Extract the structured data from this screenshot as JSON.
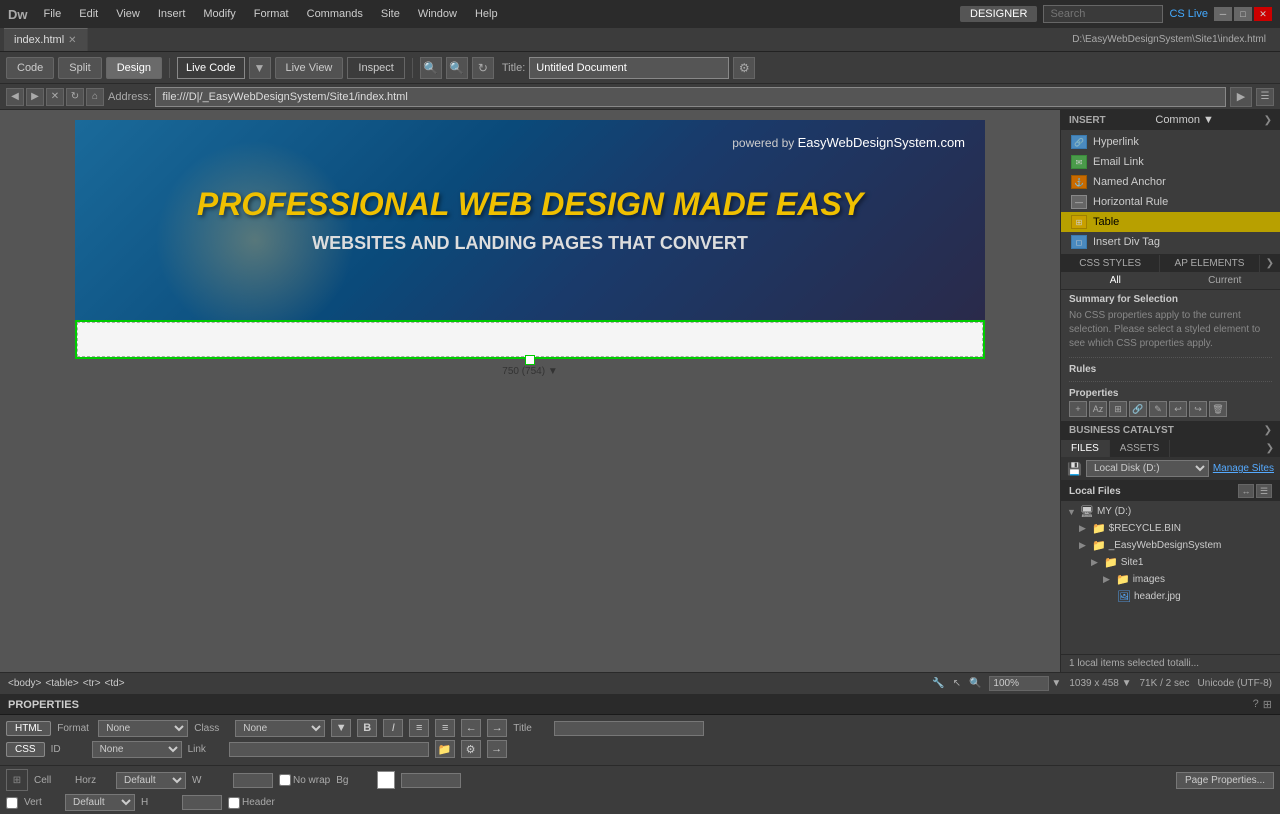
{
  "app": {
    "logo": "Dw",
    "designer_label": "DESIGNER",
    "search_placeholder": "Search",
    "cs_live_label": "CS Live"
  },
  "menu": {
    "items": [
      "File",
      "Edit",
      "View",
      "Insert",
      "Modify",
      "Format",
      "Commands",
      "Site",
      "Window",
      "Help"
    ]
  },
  "tab": {
    "name": "index.html",
    "path": "D:\\EasyWebDesignSystem\\Site1\\index.html"
  },
  "toolbar": {
    "code_label": "Code",
    "split_label": "Split",
    "design_label": "Design",
    "live_code_label": "Live Code",
    "live_view_label": "Live View",
    "inspect_label": "Inspect",
    "title_label": "Title:",
    "title_value": "Untitled Document"
  },
  "address": {
    "label": "Address:",
    "value": "file:///D|/_EasyWebDesignSystem/Site1/index.html"
  },
  "banner": {
    "powered_by": "powered by",
    "brand": "EasyWebDesignSystem.com",
    "title": "PROFESSIONAL WEB DESIGN MADE EASY",
    "subtitle": "WEBSITES AND LANDING PAGES THAT CONVERT"
  },
  "selection": {
    "width_label": "750 (754) ▼"
  },
  "status": {
    "breadcrumb": [
      "<body>",
      "<table>",
      "<tr>",
      "<td>"
    ],
    "zoom": "100%",
    "dimensions": "1039 x 458 ▼",
    "file_size": "71K / 2 sec",
    "encoding": "Unicode (UTF-8)"
  },
  "right_panel": {
    "insert_title": "INSERT",
    "common_label": "Common",
    "insert_items": [
      {
        "label": "Hyperlink",
        "icon": "🔗",
        "type": "link"
      },
      {
        "label": "Email Link",
        "icon": "✉",
        "type": "email"
      },
      {
        "label": "Named Anchor",
        "icon": "⚓",
        "type": "anchor"
      },
      {
        "label": "Horizontal Rule",
        "icon": "—",
        "type": "hr"
      },
      {
        "label": "Table",
        "icon": "⊞",
        "type": "table",
        "highlighted": true
      },
      {
        "label": "Insert Div Tag",
        "icon": "◻",
        "type": "div"
      }
    ],
    "css_title": "CSS STYLES",
    "ap_title": "AP ELEMENTS",
    "css_tab_all": "All",
    "css_tab_current": "Current",
    "css_summary": "Summary for Selection",
    "css_no_props": "No CSS properties apply to the current selection.  Please select a styled element to see which CSS properties apply.",
    "css_rules": "Rules",
    "css_properties": "Properties",
    "bc_title": "BUSINESS CATALYST",
    "files_tab": "FILES",
    "assets_tab": "ASSETS",
    "disk_label": "Local Disk (D:)",
    "manage_sites": "Manage Sites",
    "local_files_title": "Local Files",
    "file_tree": [
      {
        "label": "MY (D:)",
        "type": "computer",
        "depth": 0,
        "toggle": "▼"
      },
      {
        "label": "$RECYCLE.BIN",
        "type": "folder",
        "depth": 1,
        "toggle": "▶"
      },
      {
        "label": "_EasyWebDesignSystem",
        "type": "folder",
        "depth": 1,
        "toggle": "▶"
      },
      {
        "label": "Site1",
        "type": "folder",
        "depth": 2,
        "toggle": "▶"
      },
      {
        "label": "images",
        "type": "folder",
        "depth": 3,
        "toggle": "▶"
      },
      {
        "label": "header.jpg",
        "type": "file",
        "depth": 4
      }
    ],
    "status_count": "1 local items selected totalli..."
  },
  "properties": {
    "title": "PROPERTIES",
    "html_label": "HTML",
    "css_label": "CSS",
    "format_label": "Format",
    "format_value": "None",
    "class_label": "Class",
    "class_value": "None",
    "bold_label": "B",
    "italic_label": "I",
    "id_label": "ID",
    "id_value": "None",
    "link_label": "Link",
    "title_label": "Title",
    "cell_label": "Cell",
    "horz_label": "Horz",
    "horz_value": "Default",
    "vert_label": "Vert",
    "vert_value": "Default",
    "w_label": "W",
    "h_label": "H",
    "no_wrap_label": "No wrap",
    "header_label": "Header",
    "bg_label": "Bg",
    "page_props_label": "Page Properties..."
  }
}
